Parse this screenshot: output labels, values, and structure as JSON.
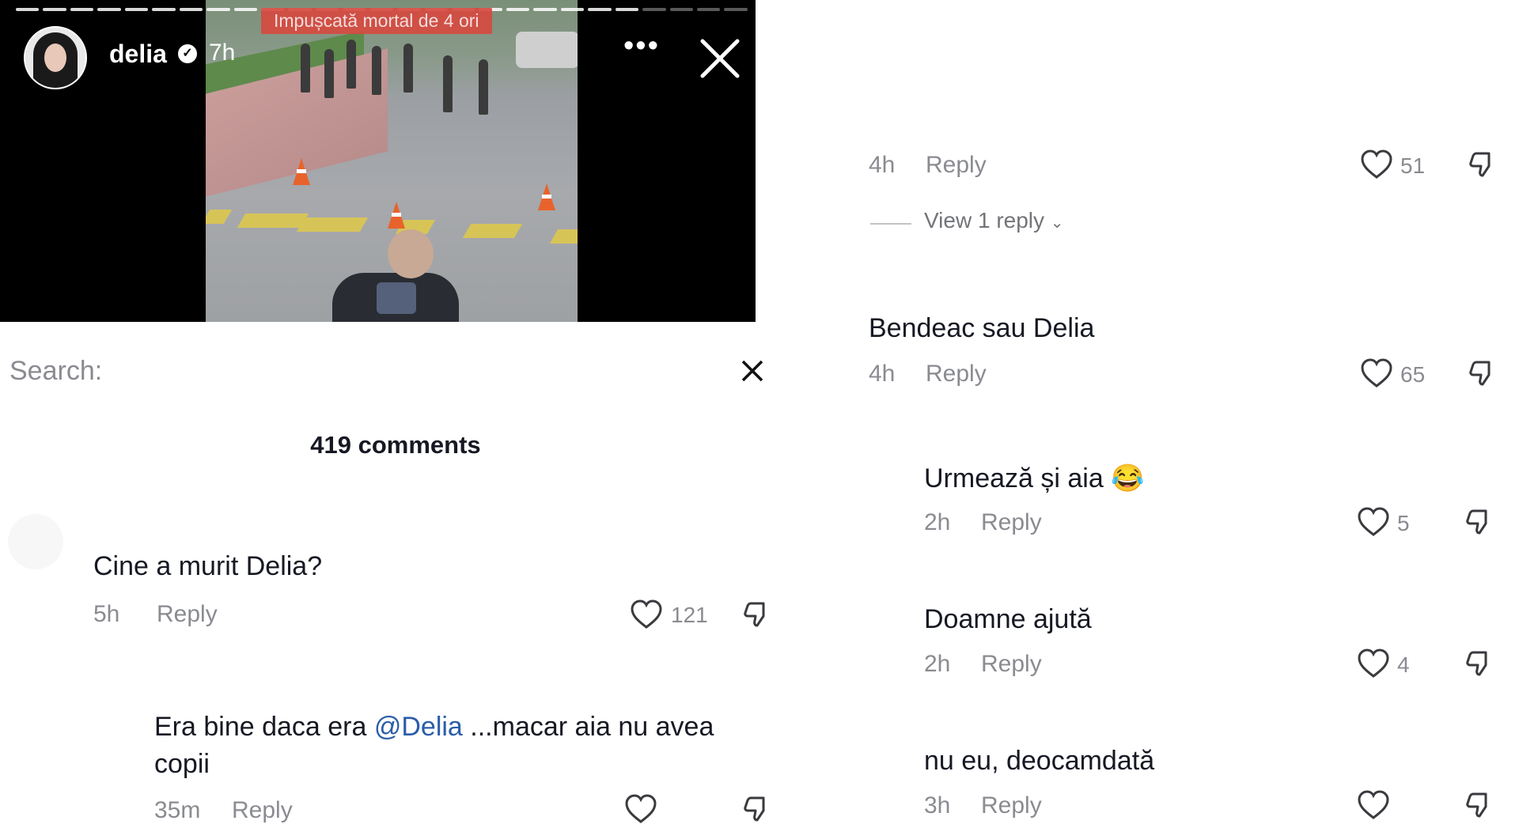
{
  "story": {
    "banner": "Impușcată mortal de 4 ori",
    "username": "delia",
    "time": "7h",
    "more_label": "•••",
    "progress_segments": [
      1,
      1,
      1,
      1,
      1,
      1,
      1,
      1,
      1,
      1,
      1,
      1,
      1,
      1,
      1,
      1,
      1,
      1,
      1,
      1,
      1,
      1,
      1,
      0,
      0,
      0,
      0
    ],
    "icons": [
      "avatar",
      "verified-icon",
      "more-icon",
      "close-icon"
    ]
  },
  "left": {
    "search_label": "Search:",
    "comment_count": "419 comments",
    "comments": [
      {
        "text": "Cine a murit Delia?",
        "time": "5h",
        "reply": "Reply",
        "likes": "121"
      },
      {
        "text_before": "Era bine daca era ",
        "mention": "@Delia",
        "text_after": " ...macar aia nu avea",
        "text_line2": "copii",
        "time": "35m",
        "reply": "Reply",
        "likes": ""
      }
    ]
  },
  "right": {
    "comments": [
      {
        "time": "4h",
        "reply": "Reply",
        "likes": "51",
        "view_replies": "View 1 reply"
      },
      {
        "text": "Bendeac sau Delia",
        "time": "4h",
        "reply": "Reply",
        "likes": "65"
      },
      {
        "text": "Urmează și aia",
        "emoji": "😂",
        "time": "2h",
        "reply": "Reply",
        "likes": "5"
      },
      {
        "text": "Doamne ajută",
        "time": "2h",
        "reply": "Reply",
        "likes": "4"
      },
      {
        "text": "nu eu, deocamdată",
        "time": "3h",
        "reply": "Reply",
        "likes": ""
      }
    ]
  },
  "colors": {
    "mention": "#2b5da8",
    "meta_gray": "#8a8b91",
    "banner_red": "#d64a40"
  }
}
